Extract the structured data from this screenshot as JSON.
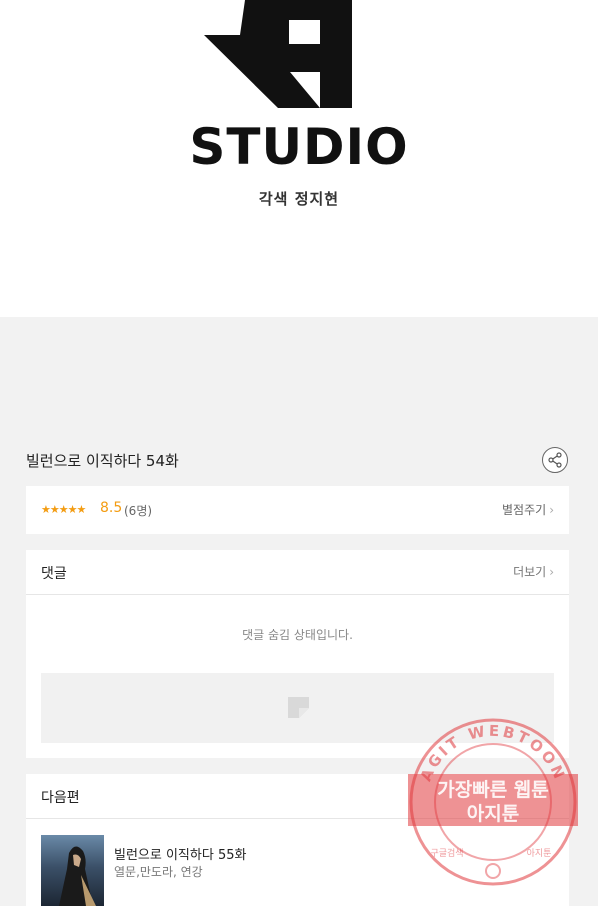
{
  "banner": {
    "studio_text": "STUDIO",
    "credit": "각색 정지현"
  },
  "episode": {
    "title": "빌런으로 이직하다 54화"
  },
  "rating": {
    "stars": "★★★★★",
    "score": "8.5",
    "count": "(6명)",
    "rate_button": "별점주기"
  },
  "comments": {
    "title": "댓글",
    "more": "더보기",
    "hidden_message": "댓글 숨김 상태입니다."
  },
  "next_episode": {
    "section_title": "다음편",
    "title": "빌런으로 이직하다 55화",
    "authors": "열문,만도라, 연강"
  },
  "watermark": {
    "ring_text": "AGIT WEBTOON",
    "line1": "가장빠른 웹툰",
    "line2": "아지툰",
    "bottom_left": "구글검색",
    "bottom_right": "아지툰"
  },
  "icons": {
    "chevron": "›",
    "share": "share-icon",
    "ad_placeholder": "image-placeholder-icon"
  },
  "colors": {
    "star": "#f39c12",
    "watermark": "#e0383d"
  }
}
